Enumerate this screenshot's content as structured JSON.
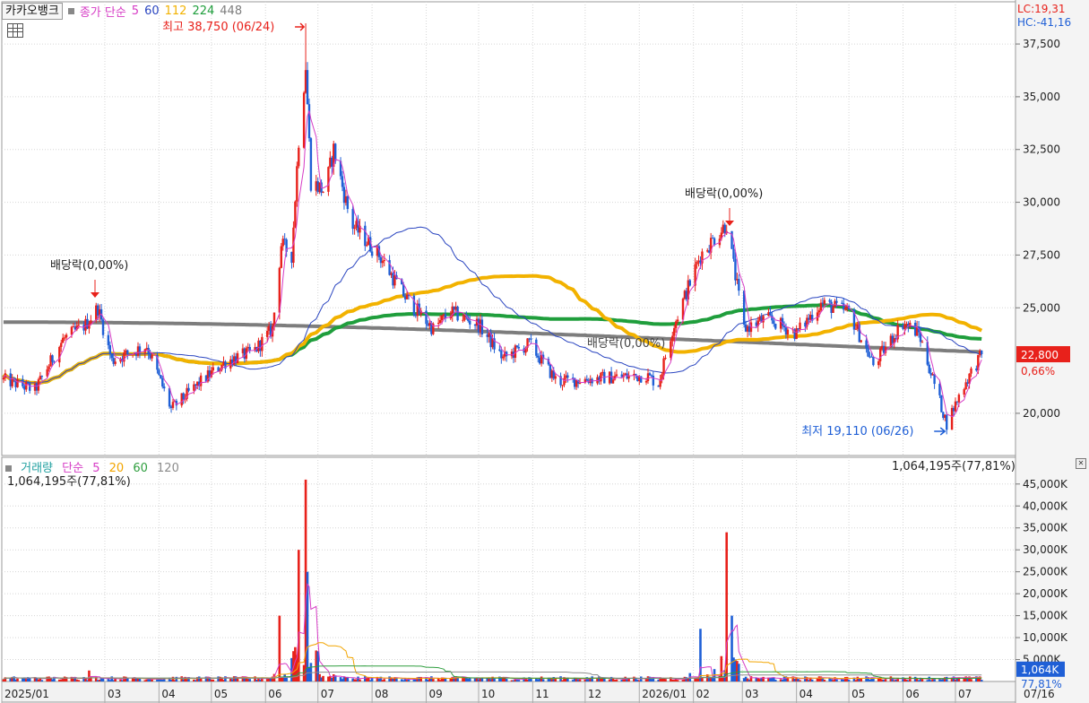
{
  "header": {
    "symbol": "카카오뱅크",
    "ma_label": "종가 단순",
    "ma_periods": [
      "5",
      "60",
      "112",
      "224",
      "448"
    ],
    "lc": "LC:19,31",
    "hc": "HC:-41,16"
  },
  "volume_header": {
    "label": "거래량",
    "ma_label": "단순",
    "ma_periods": [
      "5",
      "20",
      "60",
      "120"
    ],
    "left_readout": "1,064,195주(77,81%)",
    "right_readout": "1,064,195주(77,81%)"
  },
  "colors": {
    "up": "#e8211b",
    "down": "#1f5fd6",
    "ma5": "#d63cc5",
    "ma60": "#2a45c0",
    "ma112": "#f2b200",
    "ma224": "#1f9e3c",
    "ma448": "#7d7d7d",
    "vol_ma20": "#f2a500",
    "vol_ma60": "#2e9e3e",
    "vol_ma120": "#8c8c8c"
  },
  "chart_data": [
    {
      "type": "candlestick",
      "x_ticks": [
        "2025/01",
        "03",
        "04",
        "05",
        "06",
        "07",
        "08",
        "09",
        "10",
        "11",
        "12",
        "2026/01",
        "02",
        "03",
        "04",
        "05",
        "06",
        "07",
        "07/16"
      ],
      "y_ticks": [
        "37,500",
        "35,000",
        "32,500",
        "30,000",
        "27,500",
        "25,000",
        "20,000"
      ],
      "ylim": [
        18000,
        39500
      ],
      "current_price": "22,800",
      "current_change": "0,66%",
      "high_annotation": "최고 38,750 (06/24)",
      "low_annotation": "최저 19,110 (06/26)",
      "dividend_label": "배당락(0,00%)",
      "close_anchors": [
        [
          "2025-01-02",
          21600
        ],
        [
          "2025-01-20",
          21100
        ],
        [
          "2025-02-05",
          23500
        ],
        [
          "2025-02-18",
          24200
        ],
        [
          "2025-02-25",
          25000
        ],
        [
          "2025-03-05",
          22500
        ],
        [
          "2025-03-25",
          23200
        ],
        [
          "2025-04-08",
          20200
        ],
        [
          "2025-04-25",
          21500
        ],
        [
          "2025-05-10",
          22500
        ],
        [
          "2025-05-25",
          22900
        ],
        [
          "2025-06-05",
          24000
        ],
        [
          "2025-06-10",
          28000
        ],
        [
          "2025-06-16",
          27500
        ],
        [
          "2025-06-20",
          33000
        ],
        [
          "2025-06-24",
          36500
        ],
        [
          "2025-06-27",
          31000
        ],
        [
          "2025-07-05",
          30500
        ],
        [
          "2025-07-10",
          32500
        ],
        [
          "2025-07-20",
          29000
        ],
        [
          "2025-08-05",
          27500
        ],
        [
          "2025-08-20",
          25500
        ],
        [
          "2025-09-05",
          24000
        ],
        [
          "2025-09-15",
          24800
        ],
        [
          "2025-10-01",
          24200
        ],
        [
          "2025-10-15",
          22600
        ],
        [
          "2025-10-30",
          23300
        ],
        [
          "2025-11-15",
          21500
        ],
        [
          "2025-12-15",
          21700
        ],
        [
          "2026-01-05",
          21800
        ],
        [
          "2026-01-12",
          21400
        ],
        [
          "2026-01-20",
          24000
        ],
        [
          "2026-02-05",
          27500
        ],
        [
          "2026-02-20",
          29000
        ],
        [
          "2026-03-02",
          24000
        ],
        [
          "2026-03-15",
          24500
        ],
        [
          "2026-04-01",
          23800
        ],
        [
          "2026-04-15",
          25200
        ],
        [
          "2026-05-01",
          24800
        ],
        [
          "2026-05-15",
          22300
        ],
        [
          "2026-06-01",
          24300
        ],
        [
          "2026-06-10",
          23800
        ],
        [
          "2026-06-26",
          19500
        ],
        [
          "2026-07-05",
          21200
        ],
        [
          "2026-07-16",
          22800
        ]
      ],
      "ma5_label": "5",
      "ma60_label": "60",
      "ma112_label": "112",
      "ma224_label": "224",
      "ma448_label": "448"
    },
    {
      "type": "bar",
      "y_ticks": [
        "45,000K",
        "40,000K",
        "35,000K",
        "30,000K",
        "25,000K",
        "20,000K",
        "15,000K",
        "10,000K",
        "5,000K"
      ],
      "ylim": [
        0,
        47000
      ],
      "current_volume": "1,064K",
      "current_ratio": "77,81%",
      "spikes": [
        [
          "2025-02-20",
          2500
        ],
        [
          "2025-06-09",
          15000
        ],
        [
          "2025-06-20",
          30000
        ],
        [
          "2025-06-24",
          46000
        ],
        [
          "2025-06-25",
          25000
        ],
        [
          "2025-07-05",
          10000
        ],
        [
          "2026-02-05",
          12000
        ],
        [
          "2026-02-20",
          34000
        ],
        [
          "2026-02-23",
          15000
        ]
      ]
    }
  ]
}
